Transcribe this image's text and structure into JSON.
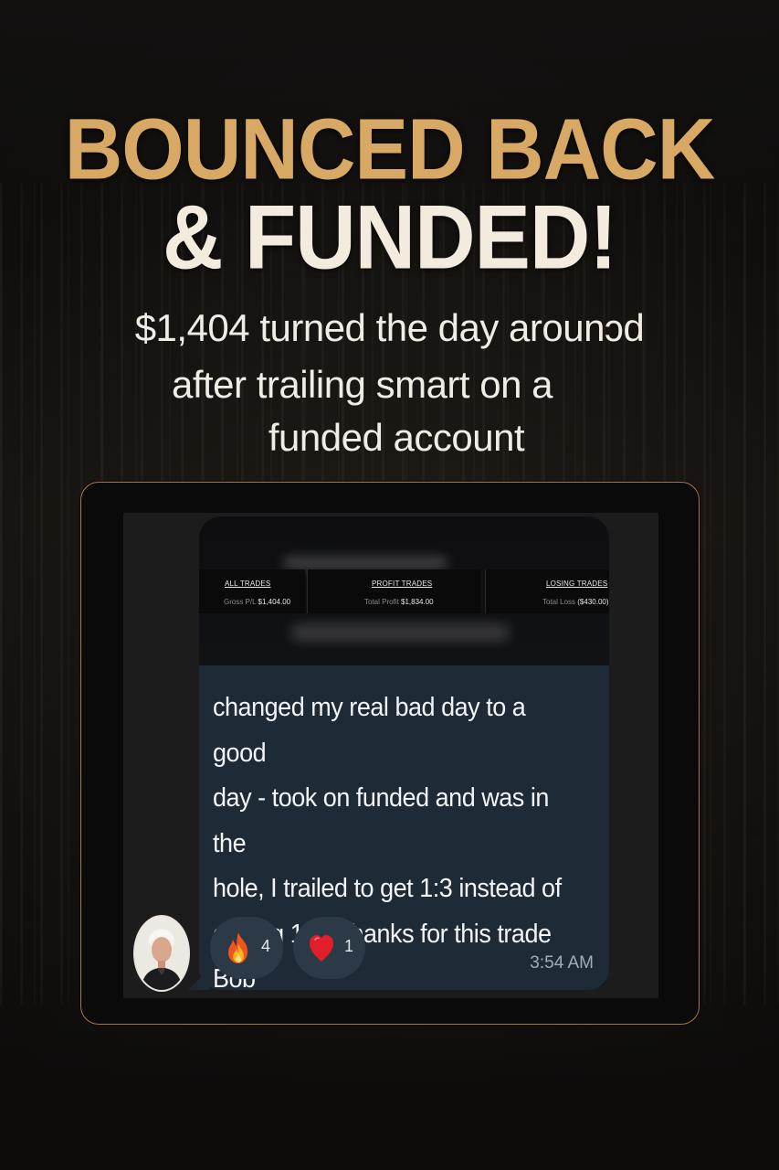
{
  "headline": {
    "line1": "BOUNCED BACK",
    "line2": "& FUNDED!"
  },
  "subheadline": {
    "line1": "$1,404 turned the day arounɔd",
    "line2": "after trailing smart on a",
    "line3": "funded account"
  },
  "trade_summary": {
    "all_trades": {
      "label": "ALL TRADES",
      "metric": "Gross P/L",
      "value": "$1,404.00"
    },
    "profit_trades": {
      "label": "PROFIT TRADES",
      "metric": "Total Profit",
      "value": "$1,834.00"
    },
    "losing_trades": {
      "label": "LOSING TRADES",
      "metric": "Total Loss",
      "value": "($430.00)"
    }
  },
  "chat": {
    "message_lines": [
      "changed my real bad day to a good",
      "day - took on funded and was in the",
      "hole, I trailed to get 1:3 instead of",
      "getting 1:8 - thanks for this trade",
      "Bob"
    ],
    "reactions": [
      {
        "icon": "fire-icon",
        "count": "4"
      },
      {
        "icon": "heart-icon",
        "count": "1"
      }
    ],
    "timestamp": "3:54 AM"
  },
  "colors": {
    "gold": "#d8a865",
    "cream": "#f3ebde",
    "bubble": "#1e2a36",
    "frame_border": "#a87a48"
  }
}
